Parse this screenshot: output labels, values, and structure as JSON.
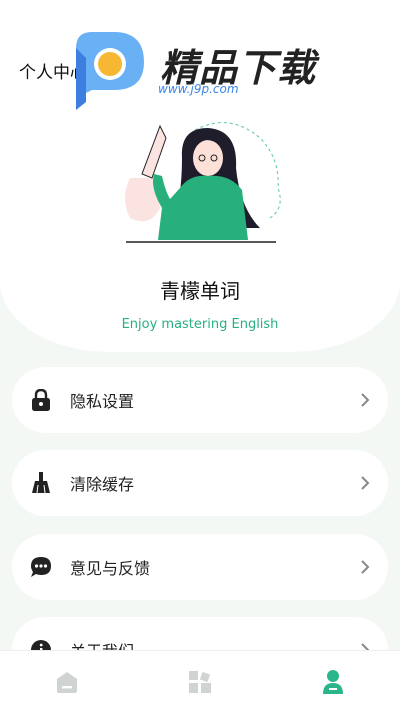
{
  "header": {
    "page_title": "个人中心",
    "app_name": "青檬单词",
    "slogan": "Enjoy mastering English"
  },
  "watermark": {
    "brand": "精品下载",
    "url": "www.j9p.com"
  },
  "menu": [
    {
      "label": "隐私设置",
      "icon": "lock-icon"
    },
    {
      "label": "清除缓存",
      "icon": "broom-icon"
    },
    {
      "label": "意见与反馈",
      "icon": "chat-bubble-icon"
    },
    {
      "label": "关于我们",
      "icon": "info-icon"
    }
  ],
  "tabbar": {
    "tabs": [
      {
        "icon": "home-icon",
        "active": false
      },
      {
        "icon": "apps-grid-icon",
        "active": false
      },
      {
        "icon": "profile-icon",
        "active": true
      }
    ]
  },
  "colors": {
    "accent": "#26b07f",
    "active_tab": "#2bb58a",
    "inactive_tab": "#cfd4d2",
    "background": "#f4f8f5"
  }
}
